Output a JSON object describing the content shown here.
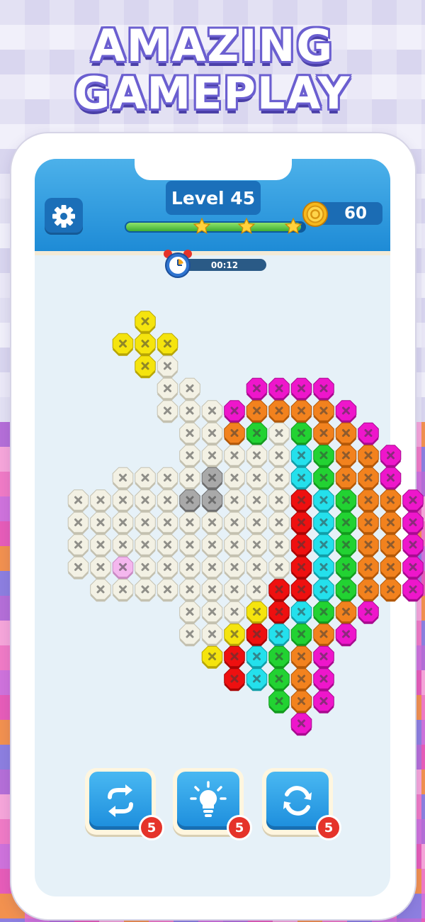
{
  "promo": {
    "line1": "AMAZING",
    "line2": "GAMEPLAY"
  },
  "hud": {
    "level_label": "Level 45",
    "coins": "60",
    "timer": "00:12",
    "progress_fraction": 0.98,
    "stars_earned": 3
  },
  "tools": [
    {
      "name": "swap",
      "icon": "swap-arrows-icon",
      "count": "5"
    },
    {
      "name": "hint",
      "icon": "lightbulb-icon",
      "count": "5"
    },
    {
      "name": "refresh",
      "icon": "refresh-icon",
      "count": "5"
    }
  ],
  "colors": {
    "Y": "#f5e40e",
    "W": "#f3f1e4",
    "G": "#a9a9a9",
    "P": "#f4b7ee",
    "M": "#ee16cb",
    "O": "#f2821e",
    "L": "#22d232",
    "C": "#24e0ec",
    "R": "#ee1010"
  },
  "board_rows": [
    "....Y..........",
    "...YYY.........",
    "....YW.........",
    ".....WW..MMMM..",
    ".....WWWMOOOOM.",
    "......WWOLWLOOM.",
    "......WWWWWCLOOM",
    "...WWWWGWWWCLOOM",
    ".WWWWWGGWWWRCLOOM",
    ".WWWWWWWWWWRCLOOM",
    ".WWWWWWWWWWRCLOOM",
    ".WWPWWWWWWWRCLOOM",
    "..WWWWWWWWRRCLOOM",
    "......WWWYRCLOM",
    "......WWYRCLOM",
    ".......YRCLOM",
    "........RCLOM",
    "..........LOM",
    "...........M"
  ]
}
